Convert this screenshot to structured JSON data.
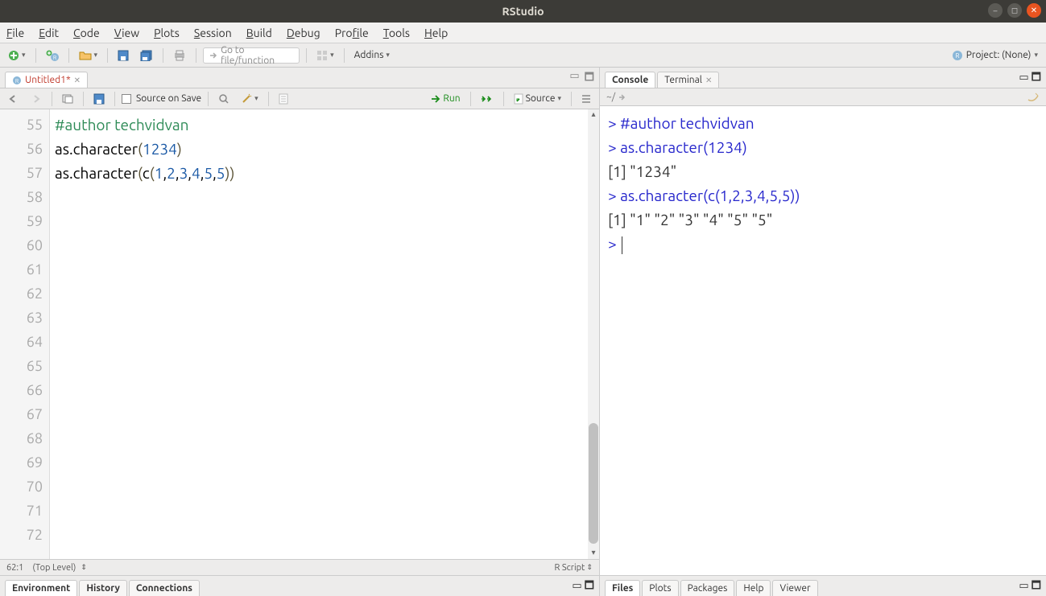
{
  "window": {
    "title": "RStudio"
  },
  "menu": [
    "File",
    "Edit",
    "Code",
    "View",
    "Plots",
    "Session",
    "Build",
    "Debug",
    "Profile",
    "Tools",
    "Help"
  ],
  "toolbar": {
    "gotofile_placeholder": "Go to file/function",
    "addins": "Addins",
    "project_label": "Project: (None)"
  },
  "source": {
    "tab_name": "Untitled1*",
    "source_on_save": "Source on Save",
    "run": "Run",
    "source_btn": "Source",
    "lines": [
      55,
      56,
      57,
      58,
      59,
      60,
      61,
      62,
      63,
      64,
      65,
      66,
      67,
      68,
      69,
      70,
      71,
      72
    ],
    "code": {
      "l55_comment": "#author techvidvan",
      "l56_a": "as.character",
      "l56_num": "1234",
      "l57_a": "as.character",
      "l57_b": "c",
      "l57_nums": [
        "1",
        "2",
        "3",
        "4",
        "5",
        "5"
      ]
    },
    "status_pos": "62:1",
    "status_scope": "(Top Level)",
    "status_lang": "R Script"
  },
  "envtabs": [
    "Environment",
    "History",
    "Connections"
  ],
  "console": {
    "tabs": [
      "Console",
      "Terminal"
    ],
    "path": "~/",
    "lines": [
      {
        "t": "prompt",
        "text": "> #author techvidvan"
      },
      {
        "t": "prompt",
        "text": "> as.character(1234)"
      },
      {
        "t": "out",
        "text": "[1] \"1234\""
      },
      {
        "t": "prompt",
        "text": "> as.character(c(1,2,3,4,5,5))"
      },
      {
        "t": "out",
        "text": "[1] \"1\" \"2\" \"3\" \"4\" \"5\" \"5\""
      },
      {
        "t": "prompt-empty",
        "text": "> "
      }
    ]
  },
  "brtabs": [
    "Files",
    "Plots",
    "Packages",
    "Help",
    "Viewer"
  ]
}
